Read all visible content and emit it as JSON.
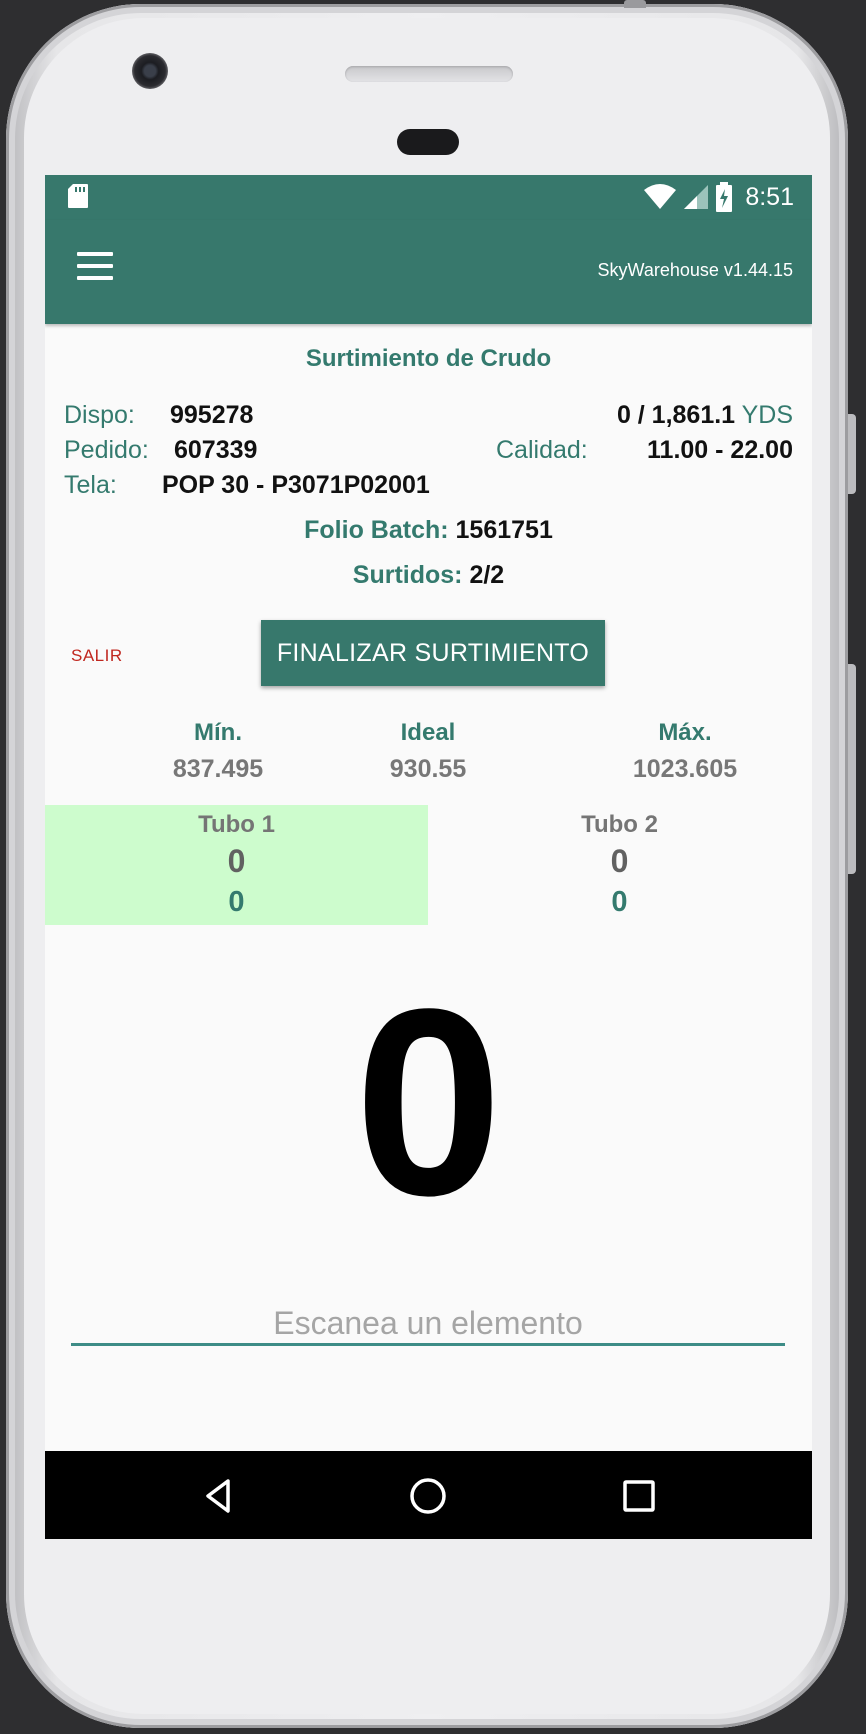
{
  "status_bar": {
    "time": "8:51",
    "icons": [
      "sd-card-icon",
      "wifi-icon",
      "signal-icon",
      "battery-charging-icon"
    ]
  },
  "app_bar": {
    "menu_icon": "menu-icon",
    "version": "SkyWarehouse v1.44.15"
  },
  "page": {
    "title": "Surtimiento de Crudo",
    "dispo_label": "Dispo:",
    "dispo_value": "995278",
    "progress_value": "0 / 1,861.1",
    "progress_unit": "YDS",
    "pedido_label": "Pedido:",
    "pedido_value": "607339",
    "calidad_label": "Calidad:",
    "calidad_value": "11.00 - 22.00",
    "tela_label": "Tela:",
    "tela_value": "POP 30 - P3071P02001",
    "folio_label": "Folio Batch:",
    "folio_value": "1561751",
    "surtidos_label": "Surtidos:",
    "surtidos_value": "2/2"
  },
  "actions": {
    "exit_label": "SALIR",
    "finish_label": "FINALIZAR SURTIMIENTO"
  },
  "limits": {
    "min_label": "Mín.",
    "min_value": "837.495",
    "ideal_label": "Ideal",
    "ideal_value": "930.55",
    "max_label": "Máx.",
    "max_value": "1023.605"
  },
  "tubes": [
    {
      "name": "Tubo 1",
      "value_a": "0",
      "value_b": "0",
      "active": true
    },
    {
      "name": "Tubo 2",
      "value_a": "0",
      "value_b": "0",
      "active": false
    }
  ],
  "counter": "0",
  "scan": {
    "value": "",
    "placeholder": "Escanea un elemento"
  },
  "nav_bar": {
    "icons": [
      "back-icon",
      "home-icon",
      "recents-icon"
    ]
  },
  "colors": {
    "primary": "#37786c",
    "accent_text": "#347a6e",
    "exit_red": "#c0271f",
    "active_tube": "#cdfccd"
  }
}
